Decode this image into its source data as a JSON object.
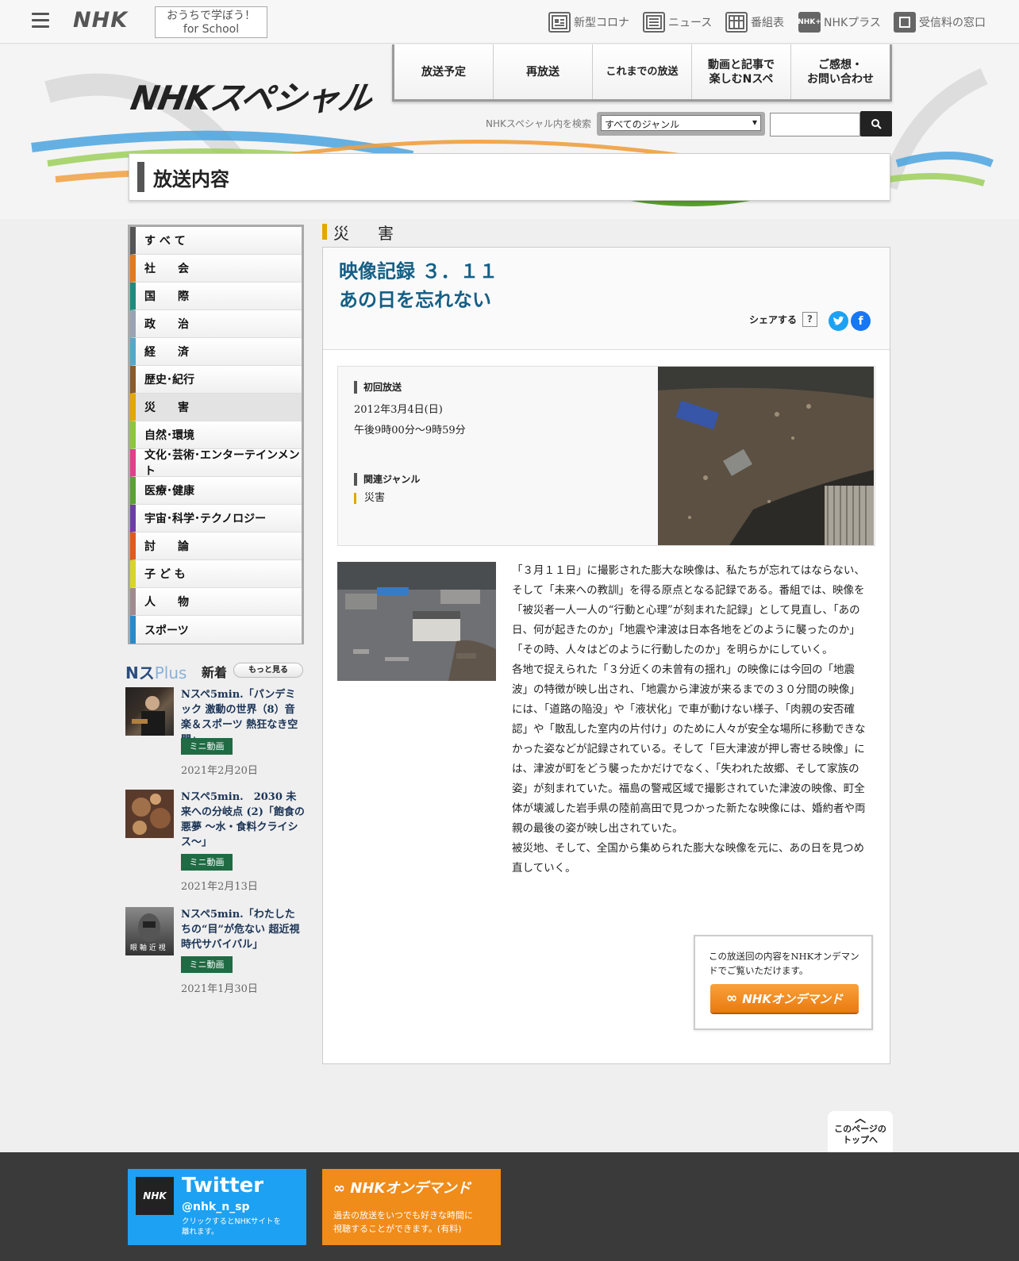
{
  "global_header": {
    "brand": "NHK",
    "school": {
      "line1": "おうちで学ぼう！",
      "line2": "for School"
    },
    "nav": [
      {
        "label": "新型コロナ",
        "icon": "corona-info-icon"
      },
      {
        "label": "ニュース",
        "icon": "news-icon"
      },
      {
        "label": "番組表",
        "icon": "tv-guide-icon"
      },
      {
        "label": "NHKプラス",
        "icon": "nhk-plus-icon"
      },
      {
        "label": "受信料の窓口",
        "icon": "license-fee-icon"
      }
    ]
  },
  "masthead": {
    "logo": "NHKスペシャル",
    "nav": [
      "放送予定",
      "再放送",
      "これまでの放送",
      "動画と記事で\n楽しむNスペ",
      "ご感想・\nお問い合わせ"
    ],
    "search_label": "NHKスペシャル内を検索",
    "genre_selected": "すべてのジャンル",
    "search_button_icon": "search-icon"
  },
  "page_title": "放送内容",
  "sidebar": {
    "genres": [
      {
        "label": "す べ て",
        "color": "#555555"
      },
      {
        "label": "社　　会",
        "color": "#e07a1f"
      },
      {
        "label": "国　　際",
        "color": "#1f8a7d"
      },
      {
        "label": "政　　治",
        "color": "#9aa3b5"
      },
      {
        "label": "経　　済",
        "color": "#55a8c8"
      },
      {
        "label": "歴史･紀行",
        "color": "#8a5a2b"
      },
      {
        "label": "災　　害",
        "color": "#e0a800"
      },
      {
        "label": "自然･環境",
        "color": "#8cc63f"
      },
      {
        "label": "文化･芸術･エンターテインメント",
        "color": "#e0408a"
      },
      {
        "label": "医療･健康",
        "color": "#5aa03a"
      },
      {
        "label": "宇宙･科学･テクノロジー",
        "color": "#6b3fa0"
      },
      {
        "label": "討　　論",
        "color": "#e05a1f"
      },
      {
        "label": "子 ど も",
        "color": "#d9d42a"
      },
      {
        "label": "人　　物",
        "color": "#a08a90"
      },
      {
        "label": "スポーツ",
        "color": "#2a8ac8"
      }
    ],
    "active_index": 6,
    "plus": {
      "logo_n": "Nス",
      "logo_plus": "Plus",
      "new_label": "新着",
      "more_label": "もっと見る",
      "items": [
        {
          "title": "Nスペ5min.「パンデミック 激動の世界（8）音楽＆スポーツ 熱狂なき空間」",
          "badge": "ミニ動画",
          "date": "2021年2月20日"
        },
        {
          "title": "Nスペ5min.　2030 未来への分岐点 (2)「飽食の悪夢 ～水・食料クライシス～」",
          "badge": "ミニ動画",
          "date": "2021年2月13日"
        },
        {
          "title": "Nスペ5min.「わたしたちの“目”が危ない 超近視時代サバイバル」",
          "badge": "ミニ動画",
          "date": "2021年1月30日",
          "thumb_caption": "眼 軸 近 視"
        }
      ]
    }
  },
  "main": {
    "genre_heading": "災　害",
    "title_line1": "映像記録 ３．１１",
    "title_line2": "あの日を忘れない",
    "share_label": "シェアする",
    "share_help": "?",
    "first_broadcast_label": "初回放送",
    "first_broadcast_date": "2012年3月4日(日)",
    "first_broadcast_time": "午後9時00分～9時59分",
    "related_genre_label": "関連ジャンル",
    "related_genre": "災害",
    "description": [
      "「３月１１日」に撮影された膨大な映像は、私たちが忘れてはならない、そして「未来への教訓」を得る原点となる記録である。番組では、映像を「被災者一人一人の“行動と心理”が刻まれた記録」として見直し、「あの日、何が起きたのか」「地震や津波は日本各地をどのように襲ったのか」「その時、人々はどのように行動したのか」を明らかにしていく。",
      "各地で捉えられた「３分近くの未曾有の揺れ」の映像には今回の「地震波」の特徴が映し出され、「地震から津波が来るまでの３０分間の映像」には、「道路の陥没」や「液状化」で車が動けない様子、「肉親の安否確認」や「散乱した室内の片付け」のために人々が安全な場所に移動できなかった姿などが記録されている。そして「巨大津波が押し寄せる映像」には、津波が町をどう襲ったかだけでなく、「失われた故郷、そして家族の姿」が刻まれていた。福島の警戒区域で撮影されていた津波の映像、町全体が壊滅した岩手県の陸前高田で見つかった新たな映像には、婚約者や両親の最後の姿が映し出されていた。",
      "被災地、そして、全国から集められた膨大な映像を元に、あの日を見つめ直していく。"
    ],
    "ondemand_text": "この放送回の内容をNHKオンデマンドでご覧いただけます。",
    "ondemand_button": "NHKオンデマンド"
  },
  "to_top": {
    "line1": "このページの",
    "line2": "トップへ"
  },
  "footer": {
    "twitter": {
      "title": "Twitter",
      "handle": "@nhk_n_sp",
      "note": "クリックするとNHKサイトを\n離れます。"
    },
    "ondemand": {
      "title": "NHKオンデマンド",
      "note": "過去の放送をいつでも好きな時間に\n視聴することができます。(有料)"
    }
  }
}
